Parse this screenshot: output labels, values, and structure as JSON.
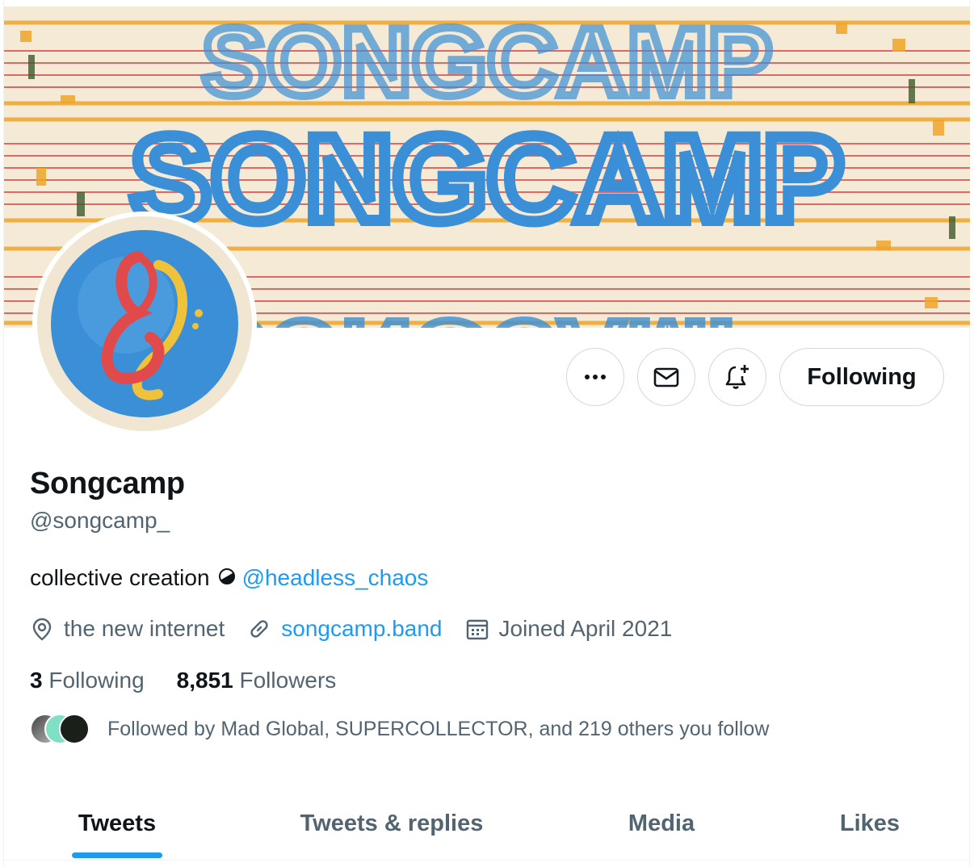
{
  "profile": {
    "name": "Songcamp",
    "handle": "@songcamp_",
    "bio_text": "collective creation",
    "bio_emoji": "◒",
    "bio_mention": "@headless_chaos",
    "location": "the new internet",
    "website": "songcamp.band",
    "joined": "Joined April 2021",
    "following_count": "3",
    "following_label": "Following",
    "followers_count": "8,851",
    "followers_label": "Followers",
    "followed_by": "Followed by Mad Global, SUPERCOLLECTOR, and 219 others you follow"
  },
  "banner": {
    "word": "SONGCAMP"
  },
  "actions": {
    "more_icon": "more-icon",
    "message_icon": "mail-icon",
    "notify_icon": "bell-plus-icon",
    "following_label": "Following"
  },
  "tabs": [
    {
      "label": "Tweets",
      "active": true
    },
    {
      "label": "Tweets & replies",
      "active": false
    },
    {
      "label": "Media",
      "active": false
    },
    {
      "label": "Likes",
      "active": false
    }
  ],
  "colors": {
    "accent": "#1d9bf0",
    "secondary_text": "#536471",
    "primary_text": "#0f1419",
    "banner_blue": "#3a8fd6",
    "banner_orange": "#f0a52a",
    "banner_red": "#d84a4a"
  }
}
